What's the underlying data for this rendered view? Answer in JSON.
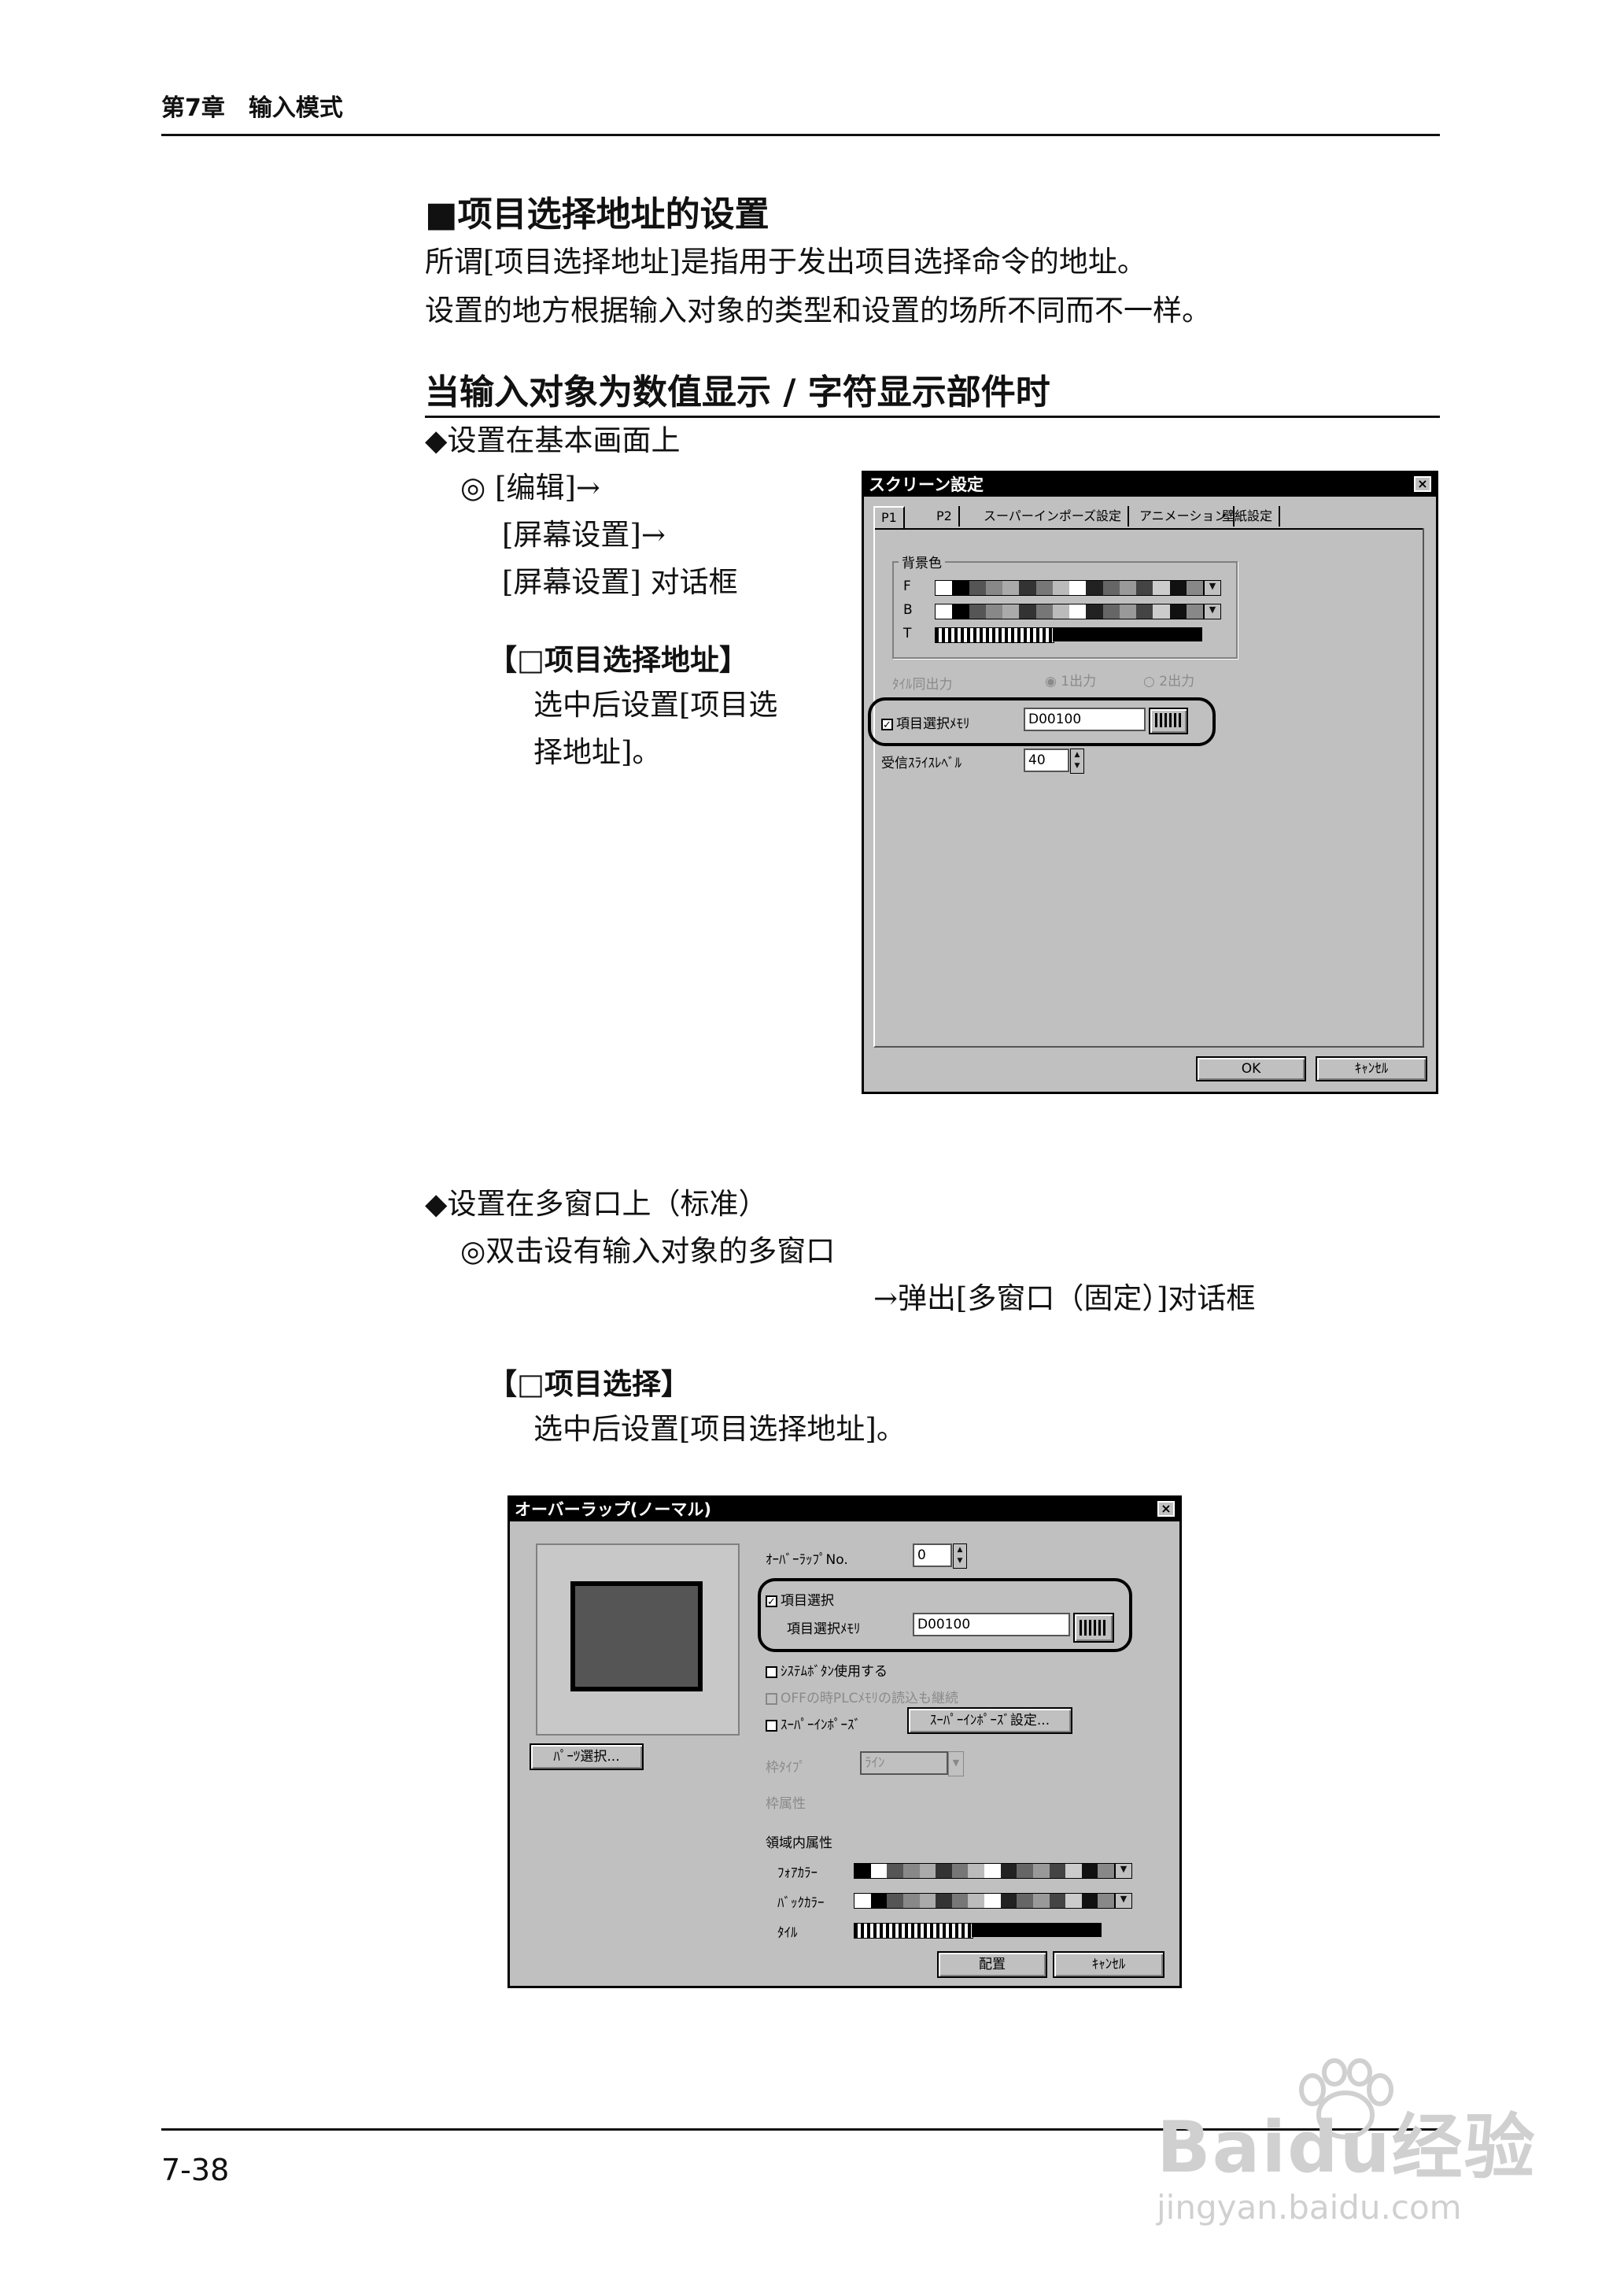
{
  "header": {
    "chapter": "第7章　输入模式"
  },
  "section": {
    "title": "■项目选择地址的设置",
    "intro1": "所谓[项目选择地址]是指用于发出项目选择命令的地址。",
    "intro2": "设置的地方根据输入对象的类型和设置的场所不同而不一样。"
  },
  "subsection": {
    "title": "当输入对象为数值显示 / 字符显示部件时"
  },
  "case1": {
    "bullet": "◆设置在基本画面上",
    "path1": "◎ [编辑]→",
    "path2": "[屏幕设置]→",
    "path3": "[屏幕设置] 对话框",
    "option_title": "【□项目选择地址】",
    "desc1": "选中后设置[项目选",
    "desc2": "择地址]。"
  },
  "case2": {
    "bullet": "◆设置在多窗口上（标准）",
    "path1": "◎双击设有输入对象的多窗口",
    "path2": "→弹出[多窗口（固定）]对话框",
    "option_title": "【□项目选择】",
    "desc": "选中后设置[项目选择地址]。"
  },
  "dialog1": {
    "title": "スクリーン設定",
    "close": "×",
    "tabs": [
      "P1",
      "P2",
      "スーパーインポーズ設定",
      "アニメーション",
      "壁紙設定"
    ],
    "group_label": "背景色",
    "row_f": "F",
    "row_b": "B",
    "row_t": "T",
    "output_label": "ﾀｲﾙ同出力",
    "radio1": "1出力",
    "radio2": "2出力",
    "check_label": "項目選択ﾒﾓﾘ",
    "check_mark": "✓",
    "address": "D00100",
    "receive_label": "受信ｽﾗｲｽﾚﾍﾞﾙ",
    "receive_value": "40",
    "ok": "OK",
    "cancel": "ｷｬﾝｾﾙ"
  },
  "dialog2": {
    "title": "オーバーラップ(ノーマル)",
    "close": "×",
    "no_label": "ｵｰﾊﾞｰﾗｯﾌﾟNo.",
    "no_value": "0",
    "item_check": "項目選択",
    "check_mark": "✓",
    "item_mem_label": "項目選択ﾒﾓﾘ",
    "address": "D00100",
    "sys_button": "ｼｽﾃﾑﾎﾞﾀﾝ使用する",
    "off_read": "OFFの時PLCﾒﾓﾘの読込も継続",
    "superimpose": "ｽｰﾊﾟｰｲﾝﾎﾟｰｽﾞ",
    "superimpose_btn": "ｽｰﾊﾟｰｲﾝﾎﾟｰｽﾞ設定...",
    "frame_type_label": "枠ﾀｲﾌﾟ",
    "frame_type_value": "ﾗｲﾝ",
    "frame_attr_label": "枠属性",
    "area_attr_label": "領域内属性",
    "fore_color": "ﾌｫｱｶﾗｰ",
    "back_color": "ﾊﾞｯｸｶﾗｰ",
    "tile": "ﾀｲﾙ",
    "parts_button": "ﾊﾟｰﾂ選択...",
    "place": "配置",
    "cancel": "ｷｬﾝｾﾙ"
  },
  "footer": {
    "page": "7-38"
  },
  "watermark": {
    "line1": "Baidu经验",
    "line2": "jingyan.baidu.com"
  }
}
